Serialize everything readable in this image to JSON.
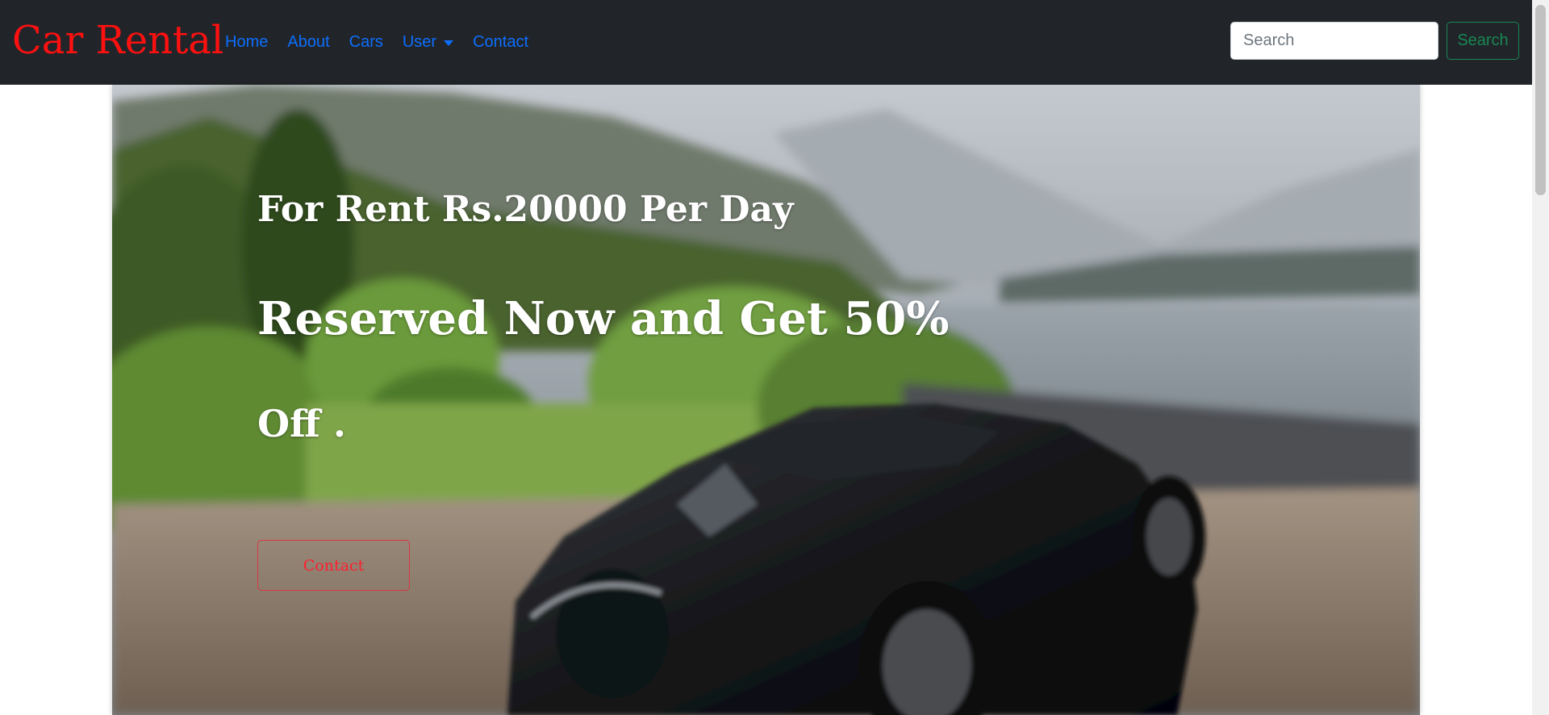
{
  "navbar": {
    "brand": "Car Rental",
    "links": {
      "home": "Home",
      "about": "About",
      "cars": "Cars",
      "user": "User",
      "contact": "Contact"
    },
    "search": {
      "placeholder": "Search",
      "button_label": "Search"
    }
  },
  "hero": {
    "line1": "For Rent Rs.20000 Per Day",
    "line2": "Reserved Now and Get 50%",
    "line3": "Off .",
    "button_label": "Contact",
    "image_subject": "black sports car parked by a lake with green bushes and mountains"
  },
  "colors": {
    "navbar_bg": "#212529",
    "brand": "#ff1010",
    "link": "#0d6efd",
    "search_button": "#198754",
    "contact_button": "#dc3545"
  },
  "icons": {
    "dropdown": "caret-down-icon"
  }
}
